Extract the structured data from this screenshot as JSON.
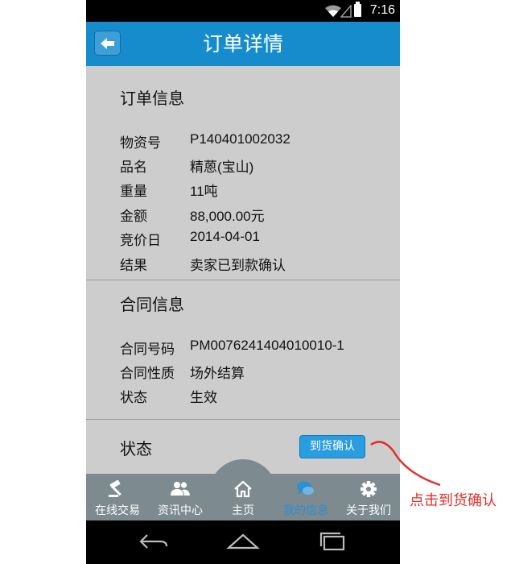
{
  "status_bar": {
    "time": "7:16"
  },
  "header": {
    "title": "订单详情",
    "back_icon": "back-arrow-icon"
  },
  "order_info": {
    "title": "订单信息",
    "rows": [
      {
        "label": "物资号",
        "value": "P140401002032"
      },
      {
        "label": "品名",
        "value": "精蒽(宝山)"
      },
      {
        "label": "重量",
        "value": "11吨"
      },
      {
        "label": "金额",
        "value": "88,000.00元"
      },
      {
        "label": "竞价日",
        "value": "2014-04-01"
      },
      {
        "label": "结果",
        "value": "卖家已到款确认"
      }
    ]
  },
  "contract_info": {
    "title": "合同信息",
    "rows": [
      {
        "label": "合同号码",
        "value": "PM0076241404010010-1"
      },
      {
        "label": "合同性质",
        "value": "场外结算"
      },
      {
        "label": "状态",
        "value": "生效"
      }
    ]
  },
  "status_section": {
    "title": "状态",
    "confirm_button": "到货确认"
  },
  "bottom_nav": {
    "items": [
      {
        "label": "在线交易",
        "icon": "gavel-icon",
        "active": false
      },
      {
        "label": "资讯中心",
        "icon": "people-icon",
        "active": false
      },
      {
        "label": "主页",
        "icon": "home-icon",
        "active": false
      },
      {
        "label": "我的信息",
        "icon": "chat-bubbles-icon",
        "active": true
      },
      {
        "label": "关于我们",
        "icon": "gear-icon",
        "active": false
      }
    ]
  },
  "annotation": {
    "text": "点击到货确认",
    "color": "#e0302a"
  },
  "colors": {
    "header": "#168ccc",
    "background": "#cdcdcd",
    "nav": "#7d8a8f",
    "active_nav": "#2b8fd1"
  }
}
